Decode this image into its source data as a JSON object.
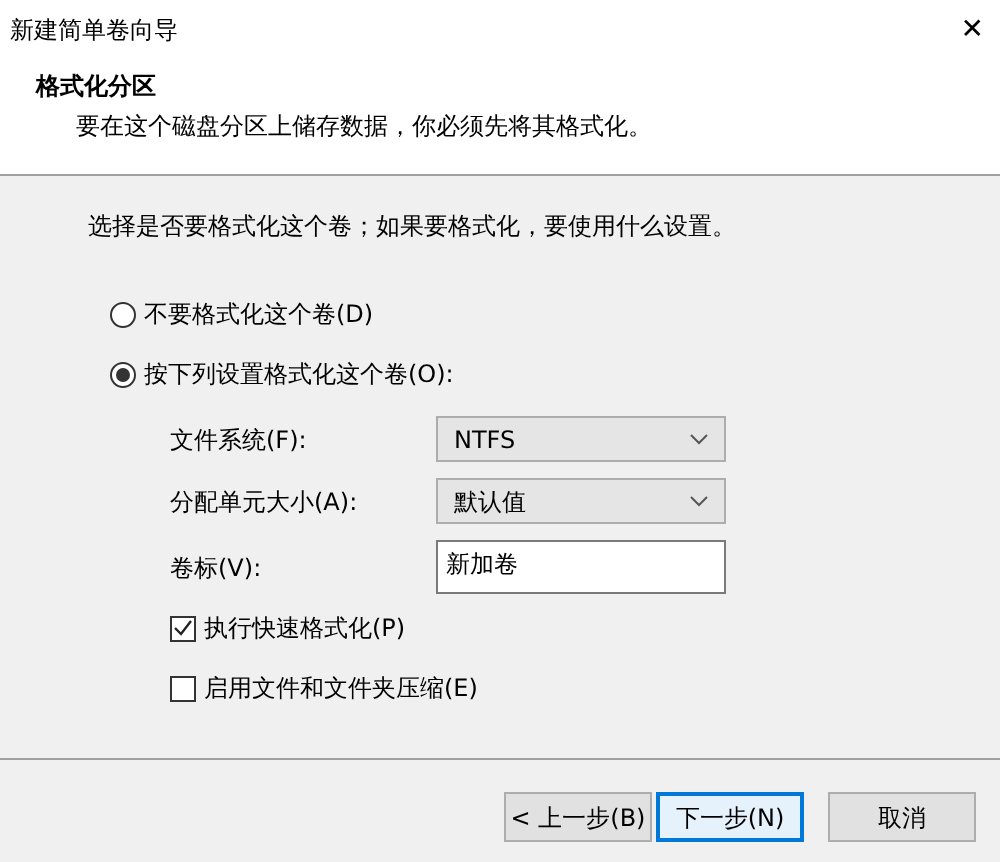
{
  "window": {
    "title": "新建简单卷向导",
    "close": "✕"
  },
  "header": {
    "title": "格式化分区",
    "subtitle": "要在这个磁盘分区上储存数据，你必须先将其格式化。"
  },
  "prompt": "选择是否要格式化这个卷；如果要格式化，要使用什么设置。",
  "options": [
    {
      "label": "不要格式化这个卷(D)",
      "selected": false
    },
    {
      "label": "按下列设置格式化这个卷(O):",
      "selected": true
    }
  ],
  "fields": [
    {
      "kind": "select",
      "label": "文件系统(F):",
      "value": "NTFS"
    },
    {
      "kind": "select",
      "label": "分配单元大小(A):",
      "value": "默认值"
    },
    {
      "kind": "text",
      "label": "卷标(V):",
      "value": "新加卷"
    }
  ],
  "checks": [
    {
      "label": "执行快速格式化(P)",
      "checked": true
    },
    {
      "label": "启用文件和文件夹压缩(E)",
      "checked": false
    }
  ],
  "buttons": [
    {
      "label": "< 上一步(B)",
      "focused": false
    },
    {
      "label": "下一步(N)",
      "focused": true
    },
    {
      "label": "取消",
      "focused": false
    }
  ]
}
